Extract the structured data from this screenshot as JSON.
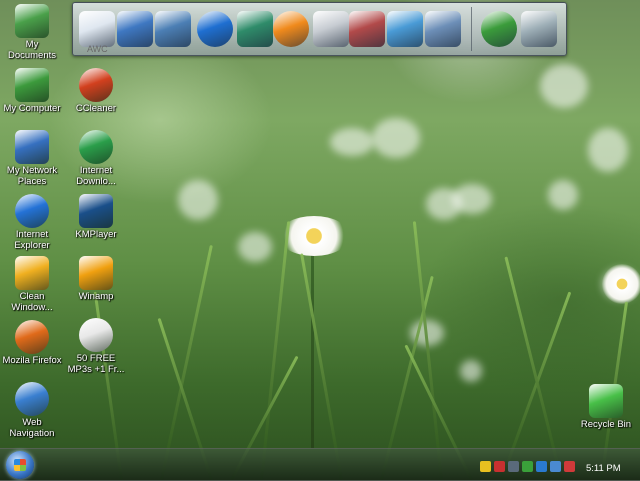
{
  "launchbar": {
    "caption": "AWC",
    "icons": [
      {
        "name": "awc-icon",
        "color": "#dfe7f0"
      },
      {
        "name": "network-computers-icon",
        "color": "#3f78c2"
      },
      {
        "name": "documents-icon",
        "color": "#4c7fb5"
      },
      {
        "name": "internet-explorer-icon",
        "color": "#1f6fd1"
      },
      {
        "name": "display-settings-icon",
        "color": "#2f8c6a"
      },
      {
        "name": "media-player-icon",
        "color": "#f08a1c"
      },
      {
        "name": "calculator-icon",
        "color": "#c7ccd2"
      },
      {
        "name": "paint-brushes-icon",
        "color": "#b24a4a"
      },
      {
        "name": "notepad-icon",
        "color": "#4a9bd6"
      },
      {
        "name": "control-panel-icon",
        "color": "#6d8fb8"
      },
      {
        "name": "windows-logo-icon",
        "color": "#3b9c3b"
      },
      {
        "name": "recycle-bin-icon",
        "color": "#9fb0b8"
      }
    ]
  },
  "desktop_icons": [
    {
      "name": "my-documents-icon",
      "label": "My Documents",
      "color": "#4aa04a"
    },
    {
      "name": "my-computer-icon",
      "label": "My Computer",
      "color": "#3c9a3c"
    },
    {
      "name": "my-network-places-icon",
      "label": "My Network Places",
      "color": "#3670c0"
    },
    {
      "name": "internet-explorer-icon",
      "label": "Internet Explorer",
      "color": "#2472d6"
    },
    {
      "name": "clean-windows-icon",
      "label": "Clean Window...",
      "color": "#f0b020"
    },
    {
      "name": "mozilla-firefox-icon",
      "label": "Mozila Firefox",
      "color": "#e06a1a"
    },
    {
      "name": "web-navigation-icon",
      "label": "Web Navigation",
      "color": "#3a7fd0"
    },
    {
      "name": "ccleaner-icon",
      "label": "CCleaner",
      "color": "#d2401e"
    },
    {
      "name": "internet-download-manager-icon",
      "label": "Internet Downlo...",
      "color": "#2a9e4a"
    },
    {
      "name": "kmplayer-icon",
      "label": "KMPlayer",
      "color": "#1a4f8a"
    },
    {
      "name": "winamp-icon",
      "label": "Winamp",
      "color": "#f0a010"
    },
    {
      "name": "free-mp3s-icon",
      "label": "50 FREE MP3s +1 Fr...",
      "color": "#e8e8e8"
    },
    {
      "name": "recycle-bin-icon",
      "label": "Recycle Bin",
      "color": "#48c048"
    }
  ],
  "taskbar": {
    "clock": "5:11 PM",
    "tray_icons": [
      {
        "name": "security-shield-icon",
        "color": "#e8c020"
      },
      {
        "name": "antivirus-icon",
        "color": "#c83030"
      },
      {
        "name": "network-icon",
        "color": "#5a6a7a"
      },
      {
        "name": "update-icon",
        "color": "#3aa03a"
      },
      {
        "name": "download-icon",
        "color": "#2a7ad0"
      },
      {
        "name": "display-icon",
        "color": "#4a8ad0"
      },
      {
        "name": "monitor-icon",
        "color": "#7a8aa0"
      },
      {
        "name": "alert-icon",
        "color": "#d03a3a"
      }
    ]
  }
}
